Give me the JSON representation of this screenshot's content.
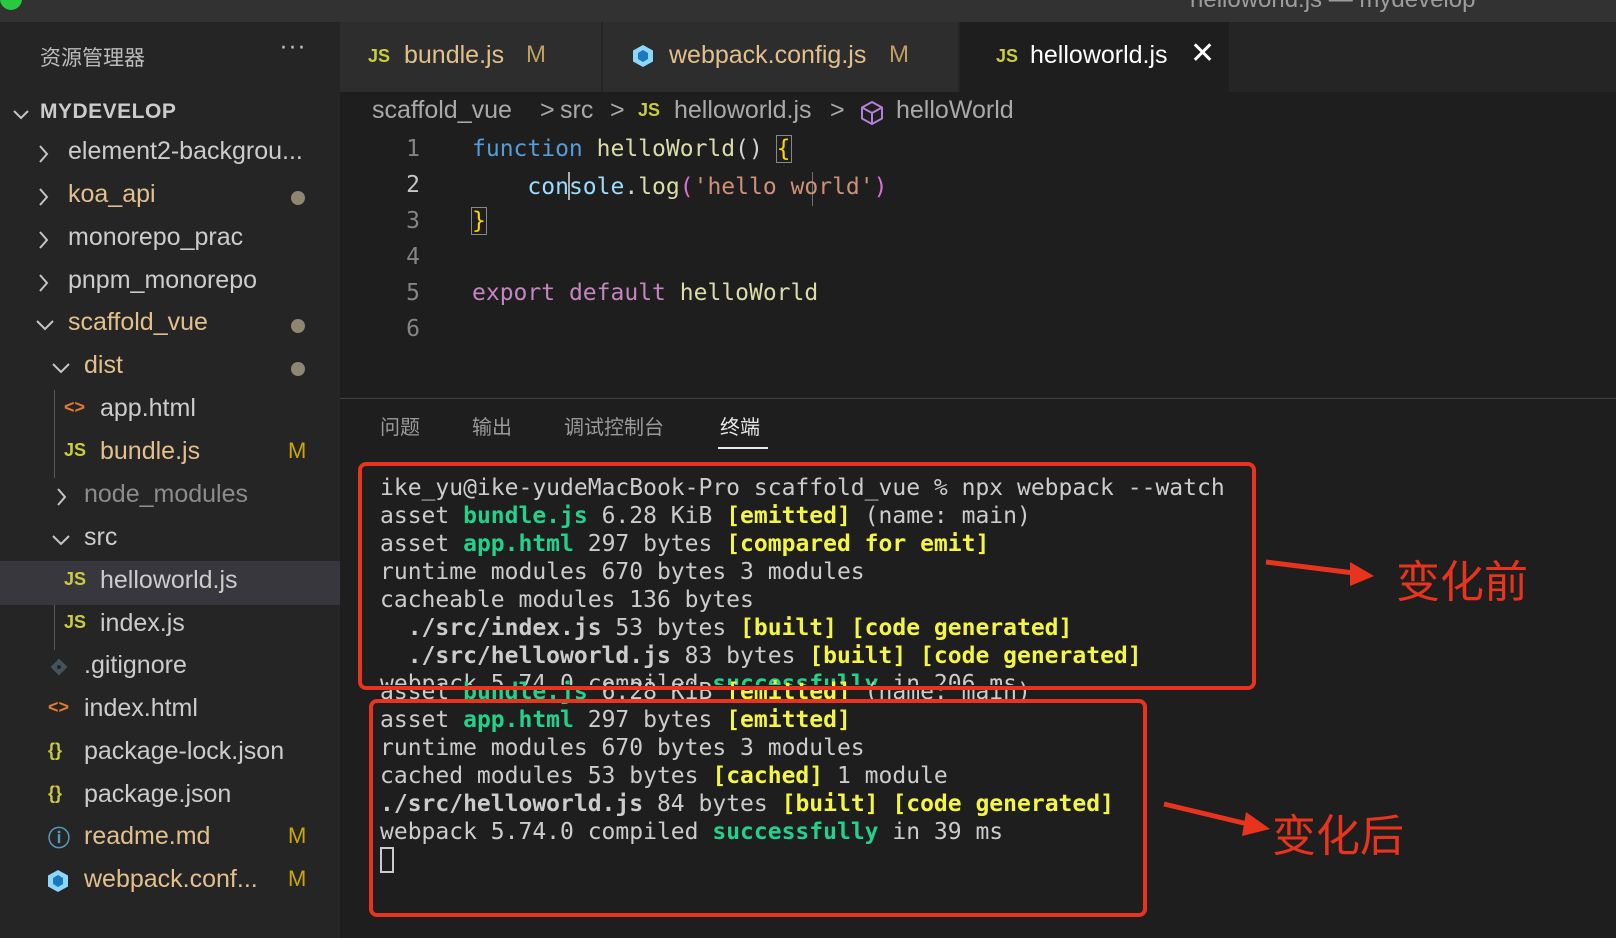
{
  "titlebar": {
    "text": "helloworld.js — mydevelop"
  },
  "sidebar": {
    "header": "资源管理器",
    "more": "···",
    "root": "MYDEVELOP",
    "items": [
      {
        "label": "element2-backgrou...",
        "icon": "folder",
        "state": "normal"
      },
      {
        "label": "koa_api",
        "icon": "folder",
        "state": "modified-dot"
      },
      {
        "label": "monorepo_prac",
        "icon": "folder",
        "state": "normal"
      },
      {
        "label": "pnpm_monorepo",
        "icon": "folder",
        "state": "normal"
      },
      {
        "label": "scaffold_vue",
        "icon": "folder-open",
        "state": "modified-dot"
      },
      {
        "label": "dist",
        "icon": "folder-open",
        "state": "modified-dot"
      },
      {
        "label": "app.html",
        "icon": "<>",
        "state": "normal"
      },
      {
        "label": "bundle.js",
        "icon": "JS",
        "badge": "M"
      },
      {
        "label": "node_modules",
        "icon": "folder",
        "state": "dim"
      },
      {
        "label": "src",
        "icon": "folder-open",
        "state": "normal"
      },
      {
        "label": "helloworld.js",
        "icon": "JS",
        "state": "selected"
      },
      {
        "label": "index.js",
        "icon": "JS",
        "state": "normal"
      },
      {
        "label": ".gitignore",
        "icon": "git-icon",
        "state": "normal"
      },
      {
        "label": "index.html",
        "icon": "<>",
        "state": "normal"
      },
      {
        "label": "package-lock.json",
        "icon": "{}",
        "state": "normal"
      },
      {
        "label": "package.json",
        "icon": "{}",
        "state": "normal"
      },
      {
        "label": "readme.md",
        "icon": "ⓘ",
        "badge": "M"
      },
      {
        "label": "webpack.conf...",
        "icon": "webpack-icon",
        "badge": "M"
      }
    ]
  },
  "tabs": [
    {
      "label": "bundle.js",
      "icon": "JS",
      "badge": "M"
    },
    {
      "label": "webpack.config.js",
      "icon": "webpack-icon",
      "badge": "M"
    },
    {
      "label": "helloworld.js",
      "icon": "JS",
      "active": true,
      "close": "✕"
    }
  ],
  "breadcrumb": [
    "scaffold_vue",
    ">",
    "src",
    ">",
    "JS",
    "helloworld.js",
    ">",
    "helloWorld"
  ],
  "editor": {
    "line_numbers": [
      "1",
      "2",
      "3",
      "4",
      "5",
      "6"
    ],
    "lines": [
      {
        "kw": "function",
        "name": "helloWorld",
        "rest": "() ",
        "brace": "{"
      },
      {
        "obj": "con",
        "obj2": "sole",
        "dot": ".",
        "method": "log",
        "open": "(",
        "str": "'hello world'",
        "close": ")"
      },
      {
        "brace": "}"
      },
      {},
      {
        "kw1": "export",
        "kw2": "default",
        "name": "helloWorld"
      },
      {}
    ]
  },
  "panel": {
    "tabs": [
      "问题",
      "输出",
      "调试控制台",
      "终端"
    ],
    "active_tab": "终端"
  },
  "terminal": {
    "before": [
      "ike_yu@ike-yudeMacBook-Pro scaffold_vue % npx webpack --watch",
      [
        "asset ",
        "bundle.js",
        " 6.28 KiB ",
        "[emitted]",
        " (name: main)"
      ],
      [
        "asset ",
        "app.html",
        " 297 bytes ",
        "[compared for emit]"
      ],
      "runtime modules 670 bytes 3 modules",
      "cacheable modules 136 bytes",
      [
        "  ./src/index.js",
        " 53 bytes ",
        "[built] [code generated]"
      ],
      [
        "  ./src/helloworld.js",
        " 83 bytes ",
        "[built] [code generated]"
      ],
      [
        "webpack 5.74.0 compiled ",
        "successfully",
        " in 206 ms"
      ]
    ],
    "after": [
      [
        "asset ",
        "bundle.js",
        " 6.28 KiB ",
        "[emitted]",
        " (name: main)"
      ],
      [
        "asset ",
        "app.html",
        " 297 bytes ",
        "[emitted]"
      ],
      "runtime modules 670 bytes 3 modules",
      [
        "cached modules 53 bytes ",
        "[cached]",
        " 1 module"
      ],
      [
        "./src/helloworld.js",
        " 84 bytes ",
        "[built] [code generated]"
      ],
      [
        "webpack 5.74.0 compiled ",
        "successfully",
        " in 39 ms"
      ]
    ]
  },
  "annotations": {
    "before": "变化前",
    "after": "变化后"
  },
  "colors": {
    "annotation_red": "#e8341c",
    "terminal_green": "#23d18b",
    "terminal_yellow": "#f5f543",
    "modified": "#e2c08d"
  }
}
